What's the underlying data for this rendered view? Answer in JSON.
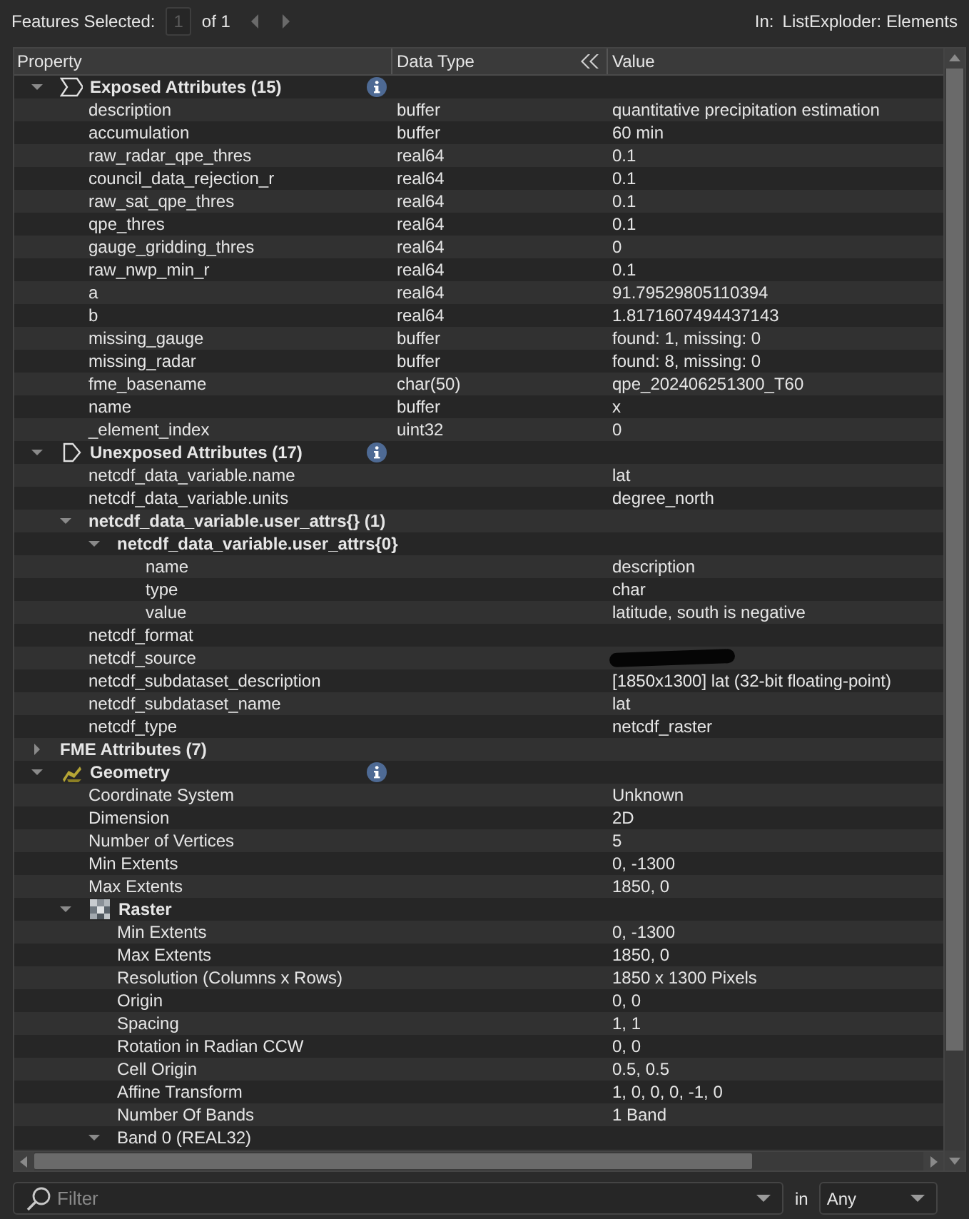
{
  "toolbar": {
    "label": "Features Selected:",
    "page": "1",
    "page_total": "of 1",
    "in_label": "In:",
    "in_value": "ListExploder: Elements"
  },
  "table": {
    "columns": [
      "Property",
      "Data Type",
      "Value"
    ],
    "rows": [
      {
        "kind": "exposed",
        "name": "Exposed Attributes (15)",
        "bold": true,
        "info": true,
        "expanded": true,
        "children": [
          {
            "name": "description",
            "type": "buffer",
            "value": "quantitative precipitation estimation"
          },
          {
            "name": "accumulation",
            "type": "buffer",
            "value": "60 min"
          },
          {
            "name": "raw_radar_qpe_thres",
            "type": "real64",
            "value": "0.1"
          },
          {
            "name": "council_data_rejection_r",
            "type": "real64",
            "value": "0.1"
          },
          {
            "name": "raw_sat_qpe_thres",
            "type": "real64",
            "value": "0.1"
          },
          {
            "name": "qpe_thres",
            "type": "real64",
            "value": "0.1"
          },
          {
            "name": "gauge_gridding_thres",
            "type": "real64",
            "value": "0"
          },
          {
            "name": "raw_nwp_min_r",
            "type": "real64",
            "value": "0.1"
          },
          {
            "name": "a",
            "type": "real64",
            "value": "91.79529805110394"
          },
          {
            "name": "b",
            "type": "real64",
            "value": "1.8171607494437143"
          },
          {
            "name": "missing_gauge",
            "type": "buffer",
            "value": "found: 1, missing: 0"
          },
          {
            "name": "missing_radar",
            "type": "buffer",
            "value": "found: 8, missing: 0"
          },
          {
            "name": "fme_basename",
            "type": "char(50)",
            "value": "qpe_202406251300_T60"
          },
          {
            "name": "name",
            "type": "buffer",
            "value": "x"
          },
          {
            "name": "_element_index",
            "type": "uint32",
            "value": "0"
          }
        ]
      },
      {
        "kind": "unexposed",
        "name": "Unexposed Attributes (17)",
        "bold": true,
        "info": true,
        "expanded": true,
        "children": [
          {
            "name": "netcdf_data_variable.name",
            "value": "lat"
          },
          {
            "name": "netcdf_data_variable.units",
            "value": "degree_north"
          },
          {
            "kind": "group",
            "name": "netcdf_data_variable.user_attrs{} (1)",
            "bold": true,
            "expanded": true,
            "children": [
              {
                "kind": "group",
                "name": "netcdf_data_variable.user_attrs{0}",
                "bold": true,
                "expanded": true,
                "children": [
                  {
                    "name": "name",
                    "value": "description"
                  },
                  {
                    "name": "type",
                    "value": "char"
                  },
                  {
                    "name": "value",
                    "value": "latitude, south is negative"
                  }
                ]
              }
            ]
          },
          {
            "name": "netcdf_format"
          },
          {
            "name": "netcdf_source",
            "redacted": true
          },
          {
            "name": "netcdf_subdataset_description",
            "value": "[1850x1300] lat (32-bit floating-point)"
          },
          {
            "name": "netcdf_subdataset_name",
            "value": "lat"
          },
          {
            "name": "netcdf_type",
            "value": "netcdf_raster"
          }
        ]
      },
      {
        "kind": "group",
        "name": "FME Attributes (7)",
        "bold": true,
        "expanded": false
      },
      {
        "kind": "geometry",
        "name": "Geometry",
        "bold": true,
        "info": true,
        "expanded": true,
        "children": [
          {
            "name": "Coordinate System",
            "value": "Unknown"
          },
          {
            "name": "Dimension",
            "value": "2D"
          },
          {
            "name": "Number of Vertices",
            "value": "5"
          },
          {
            "name": "Min Extents",
            "value": "0, -1300"
          },
          {
            "name": "Max Extents",
            "value": "1850, 0"
          },
          {
            "kind": "raster",
            "name": "Raster",
            "bold": true,
            "expanded": true,
            "children": [
              {
                "name": "Min Extents",
                "value": "0, -1300"
              },
              {
                "name": "Max Extents",
                "value": "1850, 0"
              },
              {
                "name": "Resolution (Columns x Rows)",
                "value": "1850 x 1300 Pixels"
              },
              {
                "name": "Origin",
                "value": "0, 0"
              },
              {
                "name": "Spacing",
                "value": "1, 1"
              },
              {
                "name": "Rotation in Radian CCW",
                "value": "0, 0"
              },
              {
                "name": "Cell Origin",
                "value": "0.5, 0.5"
              },
              {
                "name": "Affine Transform",
                "value": "1, 0, 0, 0, -1, 0"
              },
              {
                "name": "Number Of Bands",
                "value": "1 Band"
              },
              {
                "kind": "group",
                "name": "Band 0 (REAL32)",
                "bold": false,
                "expanded": true
              }
            ]
          }
        ]
      }
    ]
  },
  "filter": {
    "placeholder": "Filter",
    "in_label": "in",
    "scope": "Any"
  }
}
